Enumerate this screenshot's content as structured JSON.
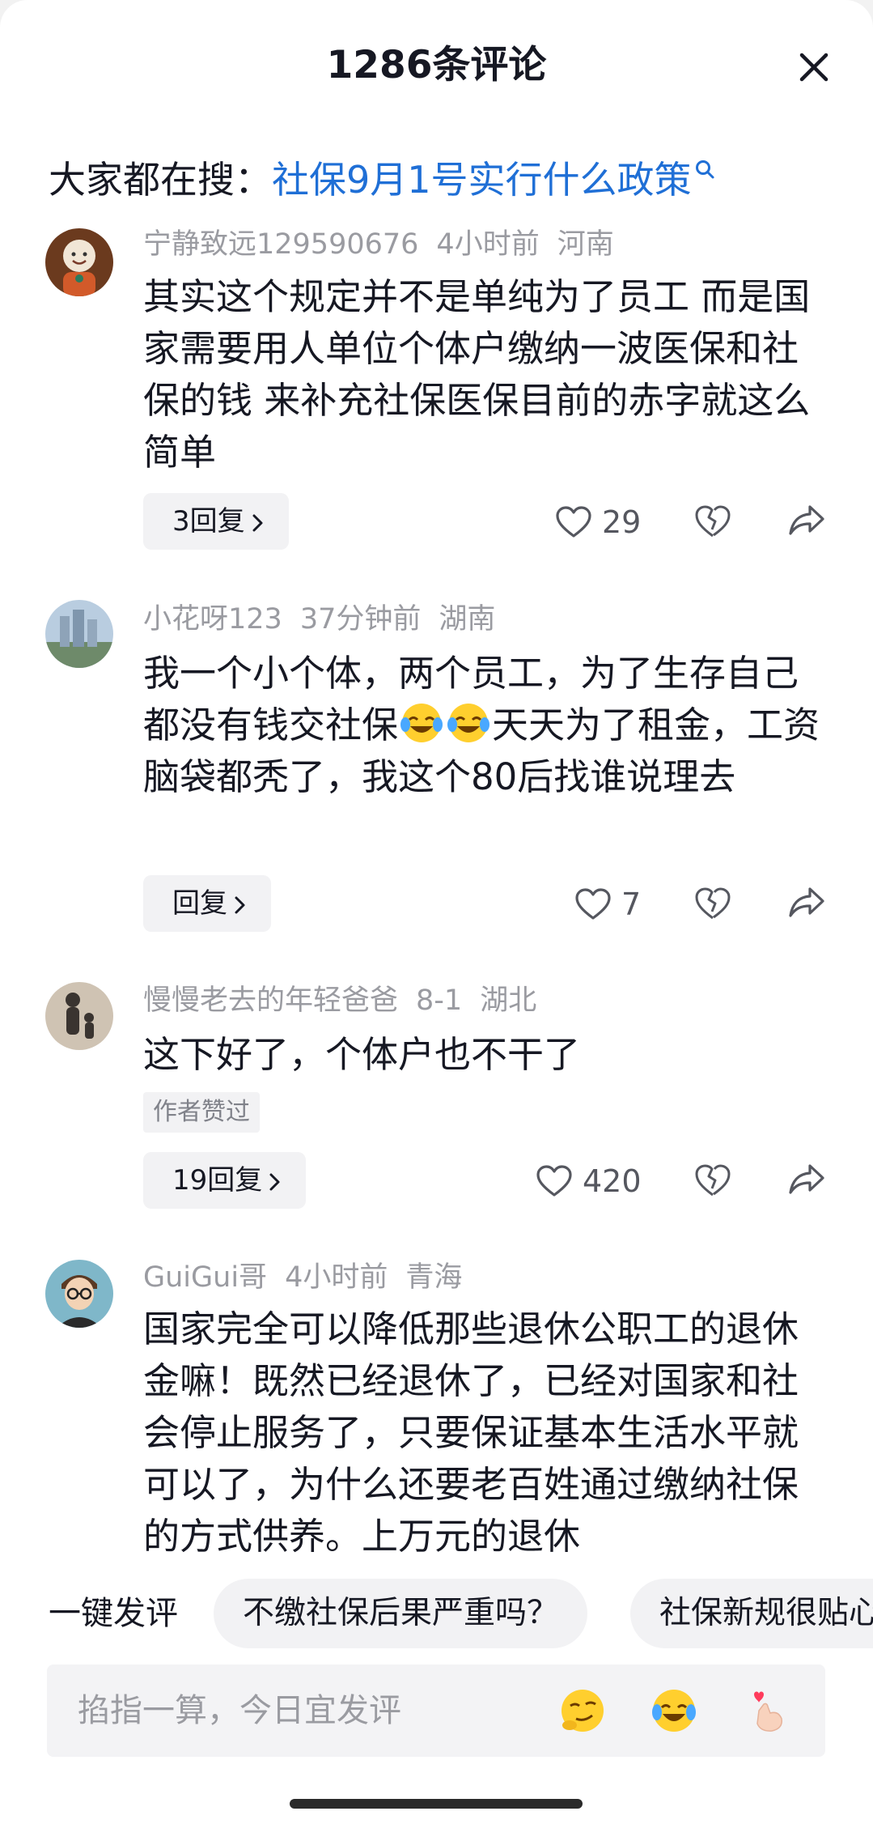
{
  "header": {
    "title": "1286条评论",
    "close_icon": "close-icon"
  },
  "search": {
    "prefix": "大家都在搜：",
    "query": "社保9月1号实行什么政策"
  },
  "comments": [
    {
      "username": "宁静致远129590676",
      "time": "4小时前",
      "location": "河南",
      "text": "其实这个规定并不是单纯为了员工 而是国家需要用人单位个体户缴纳一波医保和社保的钱 来补充社保医保目前的赤字就这么简单",
      "reply_label": "3回复",
      "likes": "29"
    },
    {
      "username": "小花呀123",
      "time": "37分钟前",
      "location": "湖南",
      "text_before": "我一个小个体，两个员工，为了生存自己都没有钱交社保",
      "text_after": "天天为了租金，工资脑袋都秃了，我这个80后找谁说理去",
      "reply_label": "回复",
      "likes": "7"
    },
    {
      "username": "慢慢老去的年轻爸爸",
      "time": "8-1",
      "location": "湖北",
      "text": "这下好了，个体户也不干了",
      "badge": "作者赞过",
      "reply_label": "19回复",
      "likes": "420"
    },
    {
      "username": "GuiGui哥",
      "time": "4小时前",
      "location": "青海",
      "text": "国家完全可以降低那些退休公职工的退休金嘛！既然已经退休了，已经对国家和社会停止服务了，只要保证基本生活水平就可以了，为什么还要老百姓通过缴纳社保的方式供养。上万元的退休"
    }
  ],
  "quick_comments": {
    "label": "一键发评",
    "chips": [
      "不缴社保后果严重吗？",
      "社保新规很贴心"
    ]
  },
  "input": {
    "placeholder": "掐指一算，今日宜发评"
  },
  "icons": [
    "close-icon",
    "search-icon",
    "heart-icon",
    "dislike-heart-icon",
    "share-icon",
    "chevron-right-icon",
    "smirk-emoji-icon",
    "laugh-cry-emoji-icon",
    "finger-heart-emoji-icon"
  ],
  "colors": {
    "accent_link": "#1f6fd6",
    "text": "#161823",
    "meta": "#9a9ba1"
  }
}
